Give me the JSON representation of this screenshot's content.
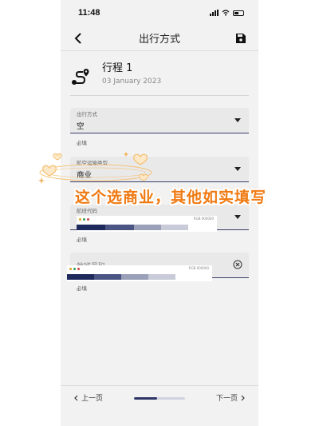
{
  "status_bar": {
    "time": "11:48"
  },
  "nav": {
    "title": "出行方式",
    "back_icon": "chevron-left-icon",
    "save_icon": "save-icon"
  },
  "trip": {
    "title": "行程 1",
    "date": "03 January 2023",
    "icon": "route-icon"
  },
  "fields": [
    {
      "label": "出行方式",
      "value": "空",
      "helper": "必填"
    },
    {
      "label": "航空运输类型",
      "value": "商业",
      "helper": "必填"
    },
    {
      "label": "航班代码",
      "value": "",
      "helper": "必填"
    },
    {
      "label": "",
      "placeholder": "航班号码",
      "helper": "必填"
    }
  ],
  "annotation": {
    "text": "这个选商业，其他如实填写",
    "color": "#f07a12"
  },
  "stripe": {
    "tag": "RGB 000000",
    "colors": [
      "#1f2a5c",
      "#4b5583",
      "#9aa0b8",
      "#c9ccd8"
    ]
  },
  "footer": {
    "prev_label": "上一页",
    "next_label": "下一页",
    "progress": 0.45
  },
  "colors": {
    "accent": "#2e3466",
    "background": "#f2f2f2",
    "field_bg": "#e9e9e9"
  }
}
